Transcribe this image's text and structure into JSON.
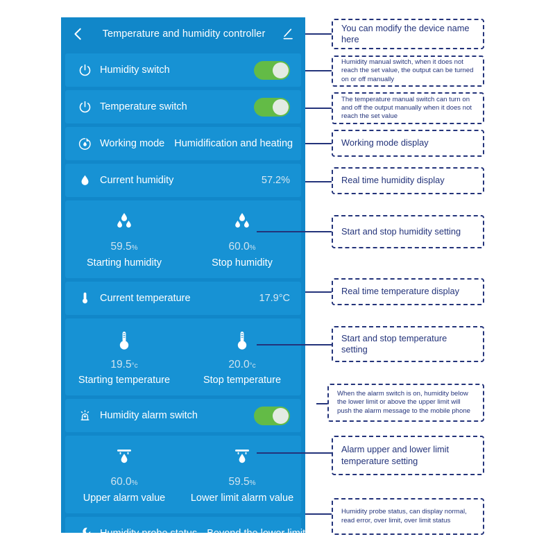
{
  "header": {
    "back_icon": "chevron-left-icon",
    "title": "Temperature and humidity controller",
    "edit_icon": "pencil-edit-icon"
  },
  "colors": {
    "panel_bg": "#1187c9",
    "card_bg": "#1792d4",
    "toggle_on": "#63bb46",
    "toggle_knob": "#e3ebe3",
    "callout_line": "#23337a",
    "value_text": "#cfe3ef"
  },
  "rows": {
    "humidity_switch": {
      "icon": "power-icon",
      "label": "Humidity switch",
      "toggle": "on"
    },
    "temperature_switch": {
      "icon": "power-icon",
      "label": "Temperature switch",
      "toggle": "on"
    },
    "working_mode": {
      "icon": "working-mode-icon",
      "label": "Working mode",
      "value": "Humidification and heating"
    },
    "current_humidity": {
      "icon": "water-drop-icon",
      "label": "Current humidity",
      "value": "57.2%"
    },
    "current_temperature": {
      "icon": "thermometer-icon",
      "label": "Current temperature",
      "value": "17.9°C"
    },
    "humidity_alarm_switch": {
      "icon": "alarm-siren-icon",
      "label": "Humidity alarm switch",
      "toggle": "on"
    },
    "humidity_probe_status": {
      "icon": "wrench-icon",
      "label": "Humidity probe status",
      "value": "Beyond the lower limit"
    }
  },
  "humidity_setting": {
    "start": {
      "icon": "double-drop-icon",
      "value": "59.5",
      "unit": "%",
      "caption": "Starting humidity"
    },
    "stop": {
      "icon": "double-drop-icon",
      "value": "60.0",
      "unit": "%",
      "caption": "Stop humidity"
    }
  },
  "temperature_setting": {
    "start": {
      "icon": "thermometer-bulb-icon",
      "value": "19.5",
      "unit": "°c",
      "caption": "Starting temperature"
    },
    "stop": {
      "icon": "thermometer-bulb-icon",
      "value": "20.0",
      "unit": "°c",
      "caption": "Stop temperature"
    }
  },
  "alarm_setting": {
    "upper": {
      "icon": "drip-limit-icon",
      "value": "60.0",
      "unit": "%",
      "caption": "Upper alarm value"
    },
    "lower": {
      "icon": "drip-limit-icon",
      "value": "59.5",
      "unit": "%",
      "caption": "Lower limit alarm value"
    }
  },
  "callouts": {
    "device_name": "You can modify the device name here",
    "humidity_switch": "Humidity manual switch, when it does not reach the set value, the output can be turned on or off manually",
    "temperature_switch": "The temperature manual switch can turn on and off the output manually when it does not reach the set value",
    "working_mode": "Working mode display",
    "current_humidity": "Real time humidity display",
    "humidity_setting": "Start and stop humidity setting",
    "current_temperature": "Real time temperature display",
    "temperature_setting": "Start and stop temperature setting",
    "alarm_switch": "When the alarm switch is on, humidity below the lower limit or above the upper limit will push the alarm message to the mobile phone",
    "alarm_setting": "Alarm upper and lower limit temperature setting",
    "probe_status": "Humidity probe status, can display normal, read error, over limit, over limit status"
  }
}
